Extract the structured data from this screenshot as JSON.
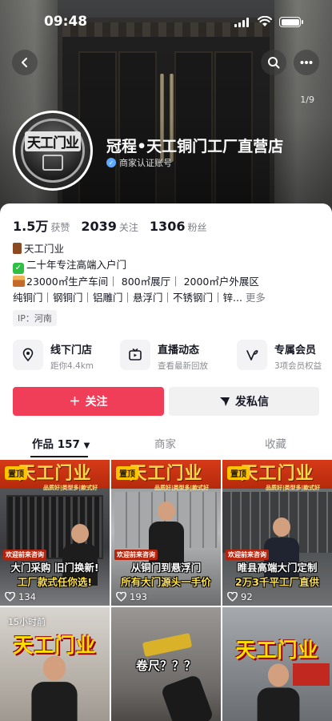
{
  "status_bar": {
    "time": "09:48"
  },
  "header": {
    "page_indicator": "1/9"
  },
  "profile": {
    "avatar_text": "天工门业",
    "name": "冠程•天工铜门工厂直营店",
    "verified_label": "商家认证账号"
  },
  "stats": [
    {
      "value": "1.5万",
      "label": "获赞"
    },
    {
      "value": "2039",
      "label": "关注"
    },
    {
      "value": "1306",
      "label": "粉丝"
    }
  ],
  "bio": {
    "line1": "天工门业",
    "line2": "二十年专注高端入户门",
    "line3": "23000㎡生产车间｜ 800㎡展厅｜ 2000㎡户外展区",
    "line4": "纯铜门｜钢铜门｜铝雕门｜悬浮门｜不锈钢门｜锌...",
    "more": "更多"
  },
  "ip": "IP：河南",
  "features": [
    {
      "title": "线下门店",
      "sub": "距你4.4km"
    },
    {
      "title": "直播动态",
      "sub": "查看最新回放"
    },
    {
      "title": "专属会员",
      "sub": "3项会员权益"
    }
  ],
  "actions": {
    "follow": "关注",
    "message": "发私信"
  },
  "tabs": {
    "works": "作品 157",
    "shop": "商家",
    "favorites": "收藏"
  },
  "videos": [
    {
      "pinned": "置顶",
      "banner": "天工门业",
      "slogan": "品质好|类型多|款式好",
      "welcome": "欢迎前来咨询",
      "caption1": "大门采购 旧门换新!",
      "caption2": "工厂款式任你选!",
      "likes": "134"
    },
    {
      "pinned": "置顶",
      "banner": "天工门业",
      "slogan": "品质好|类型多|款式好",
      "welcome": "欢迎前来咨询",
      "caption1": "从铜门到悬浮门",
      "caption2": "所有大门源头一手价",
      "likes": "193"
    },
    {
      "pinned": "置顶",
      "banner": "天工门业",
      "slogan": "品质好|类型多|款式好",
      "welcome": "欢迎前来咨询",
      "caption1": "睢县高端大门定制",
      "caption2": "2万3千平工厂直供",
      "likes": "92"
    },
    {
      "time": "15小时前",
      "logo": "天工门业"
    },
    {
      "question": "卷尺？？？"
    },
    {
      "logo": "天工门业"
    }
  ]
}
